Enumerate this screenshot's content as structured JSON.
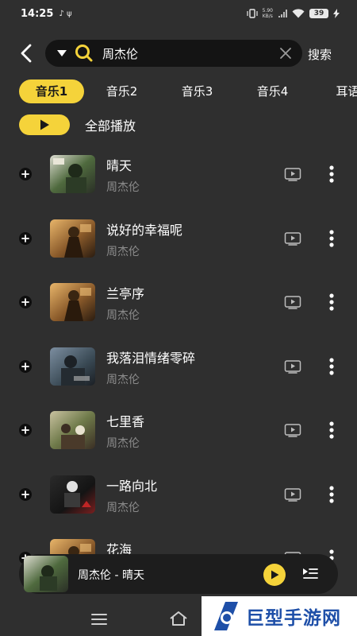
{
  "status_bar": {
    "time": "14:25",
    "extra_icons": "♪ ψ",
    "net_speed_value": "5.90",
    "net_speed_unit": "KB/s",
    "battery": "39"
  },
  "search": {
    "query": "周杰伦",
    "button_label": "搜索"
  },
  "tabs": [
    {
      "label": "音乐1",
      "active": true
    },
    {
      "label": "音乐2",
      "active": false
    },
    {
      "label": "音乐3",
      "active": false
    },
    {
      "label": "音乐4",
      "active": false
    },
    {
      "label": "耳语",
      "active": false
    }
  ],
  "play_all": {
    "label": "全部播放"
  },
  "songs": [
    {
      "title": "晴天",
      "artist": "周杰伦",
      "cover": "cover-a"
    },
    {
      "title": "说好的幸福呢",
      "artist": "周杰伦",
      "cover": "cover-b"
    },
    {
      "title": "兰亭序",
      "artist": "周杰伦",
      "cover": "cover-b"
    },
    {
      "title": "我落泪情绪零碎",
      "artist": "周杰伦",
      "cover": "cover-c"
    },
    {
      "title": "七里香",
      "artist": "周杰伦",
      "cover": "cover-d"
    },
    {
      "title": "一路向北",
      "artist": "周杰伦",
      "cover": "cover-e"
    },
    {
      "title": "花海",
      "artist": "",
      "cover": "cover-b"
    }
  ],
  "mini_player": {
    "now_playing": "周杰伦 - 晴天"
  },
  "watermark": {
    "text": "巨型手游网"
  },
  "icons": {
    "back": "chevron-left-icon",
    "dropdown": "triangle-down-icon",
    "search": "search-icon",
    "clear": "close-icon",
    "add": "plus-circle-icon",
    "mv": "video-icon",
    "more": "more-vertical-icon",
    "play": "play-icon",
    "playlist": "playlist-icon",
    "menu": "menu-icon",
    "home": "home-icon"
  },
  "colors": {
    "background": "#2f2f2f",
    "accent": "#f5d33a",
    "search_bg": "#141414",
    "secondary_text": "#8c8c8c",
    "watermark_blue": "#1e4fa8"
  }
}
